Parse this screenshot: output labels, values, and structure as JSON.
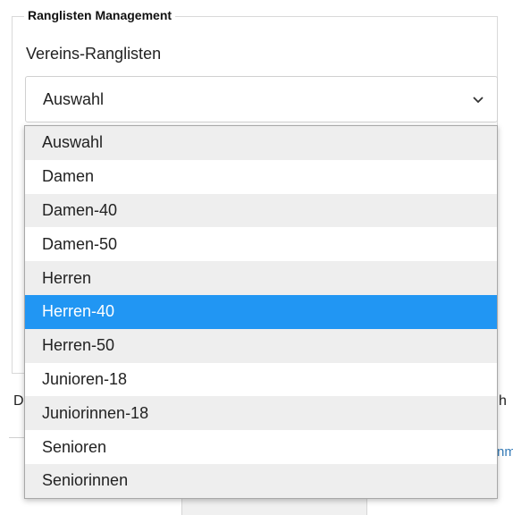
{
  "section": {
    "legend": "Ranglisten Management"
  },
  "field": {
    "label": "Vereins-Ranglisten",
    "selected_value": "Auswahl",
    "chevron_icon": "chevron-down-icon"
  },
  "dropdown": {
    "options": [
      "Auswahl",
      "Damen",
      "Damen-40",
      "Damen-50",
      "Herren",
      "Herren-40",
      "Herren-50",
      "Junioren-18",
      "Juniorinnen-18",
      "Senioren",
      "Seniorinnen"
    ],
    "highlighted": "Herren-40"
  },
  "background": {
    "left_fragment": "D",
    "right_fragment": "h",
    "link_fragment": "nm"
  },
  "colors": {
    "highlight": "#2196f3"
  }
}
